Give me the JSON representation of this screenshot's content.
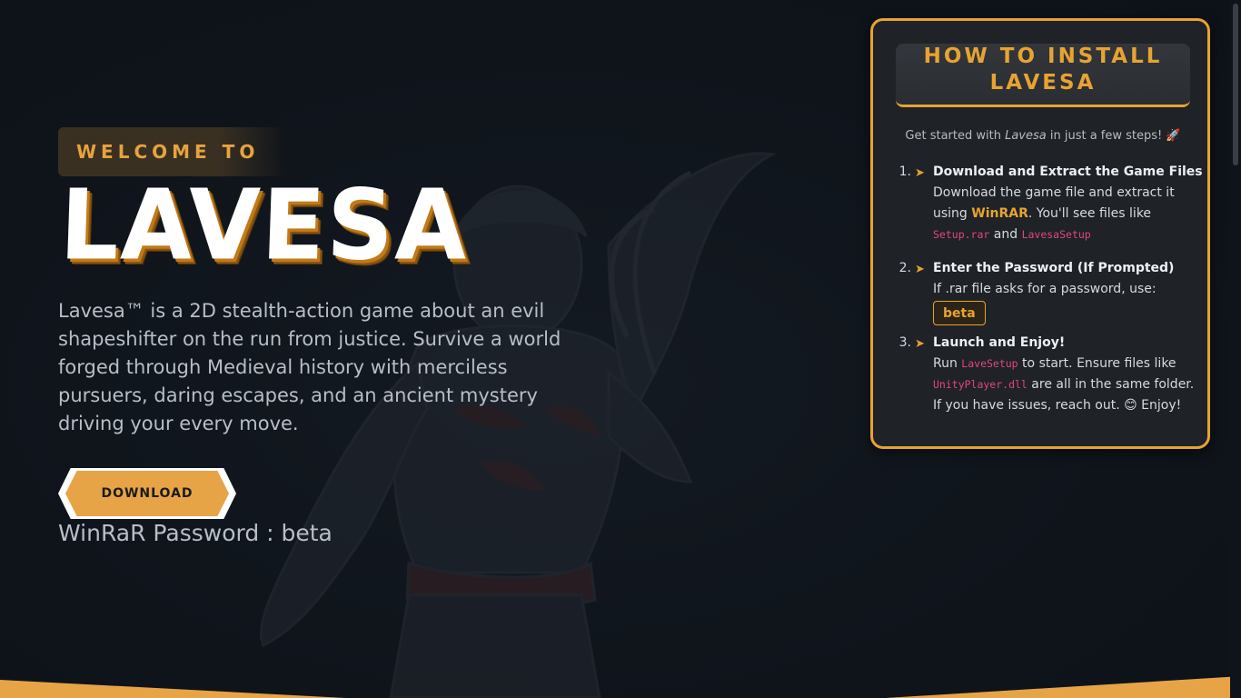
{
  "hero": {
    "welcome_label": "WELCOME TO",
    "title": "LAVESA",
    "description": "Lavesa™ is a 2D stealth-action game about an evil shapeshifter on the run from justice. Survive a world forged through Medieval history with merciless pursuers, daring escapes, and an ancient mystery driving your every move.",
    "download_label": "DOWNLOAD",
    "password_line": "WinRaR Password : beta"
  },
  "install_card": {
    "title": "HOW TO INSTALL LAVESA",
    "intro_prefix": "Get started with ",
    "intro_game": "Lavesa",
    "intro_suffix": " in just a few steps! 🚀",
    "steps": [
      {
        "number": "1.",
        "arrow": "➤",
        "title": "Download and Extract the Game Files",
        "body_1": "Download the game file and extract it using ",
        "highlight": "WinRAR",
        "body_2": ". You'll see files like ",
        "file_1": "Setup.rar",
        "body_3": " and ",
        "file_2": "LavesaSetup"
      },
      {
        "number": "2.",
        "arrow": "➤",
        "title": "Enter the Password (If Prompted)",
        "body_1": "If .rar file asks for a password, use:",
        "password": "beta"
      },
      {
        "number": "3.",
        "arrow": "➤",
        "title": "Launch and Enjoy!",
        "body_1": "Run ",
        "file_1": "LaveSetup",
        "body_2": " to start. Ensure files like ",
        "file_2": "UnityPlayer.dll",
        "body_3": " are all in the same folder. If you have issues, reach out. 😊 Enjoy!"
      }
    ]
  },
  "colors": {
    "accent": "#e8a330",
    "background": "#0f141b",
    "card_background": "#1f2227",
    "code_pink": "#e0487c"
  }
}
